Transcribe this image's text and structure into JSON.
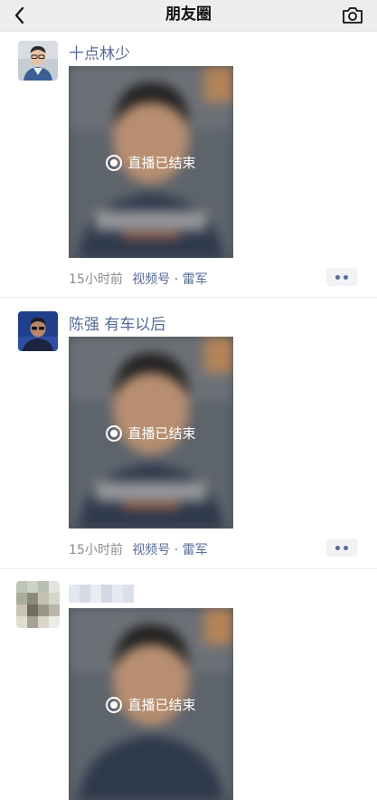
{
  "nav": {
    "title": "朋友圈"
  },
  "posts": [
    {
      "author": "十点林少",
      "live_status": "直播已结束",
      "time": "15小时前",
      "source": "视频号 · 雷军"
    },
    {
      "author": "陈强 有车以后",
      "live_status": "直播已结束",
      "time": "15小时前",
      "source": "视频号 · 雷军"
    },
    {
      "author": "",
      "live_status": "直播已结束"
    }
  ],
  "icons": {
    "back": "chevron-left-icon",
    "camera": "camera-icon",
    "more": "more-dots-icon",
    "live": "live-ended-icon"
  },
  "colors": {
    "nav_bg": "#ededed",
    "author_link": "#576b95",
    "meta_text": "#8c8c8c"
  }
}
